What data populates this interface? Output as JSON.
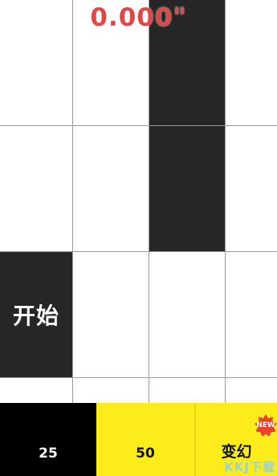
{
  "game": {
    "timer": "0.000\"",
    "start_label": "开始"
  },
  "modes": {
    "tab_25": "25",
    "tab_50": "50",
    "tab_bianhuan": "变幻",
    "new_badge": "NEW"
  },
  "watermark": "KKJ下载",
  "colors": {
    "black_tile": "#262626",
    "timer": "#e04848",
    "mode_yellow": "#fcec1b",
    "badge_red": "#e8412c"
  }
}
